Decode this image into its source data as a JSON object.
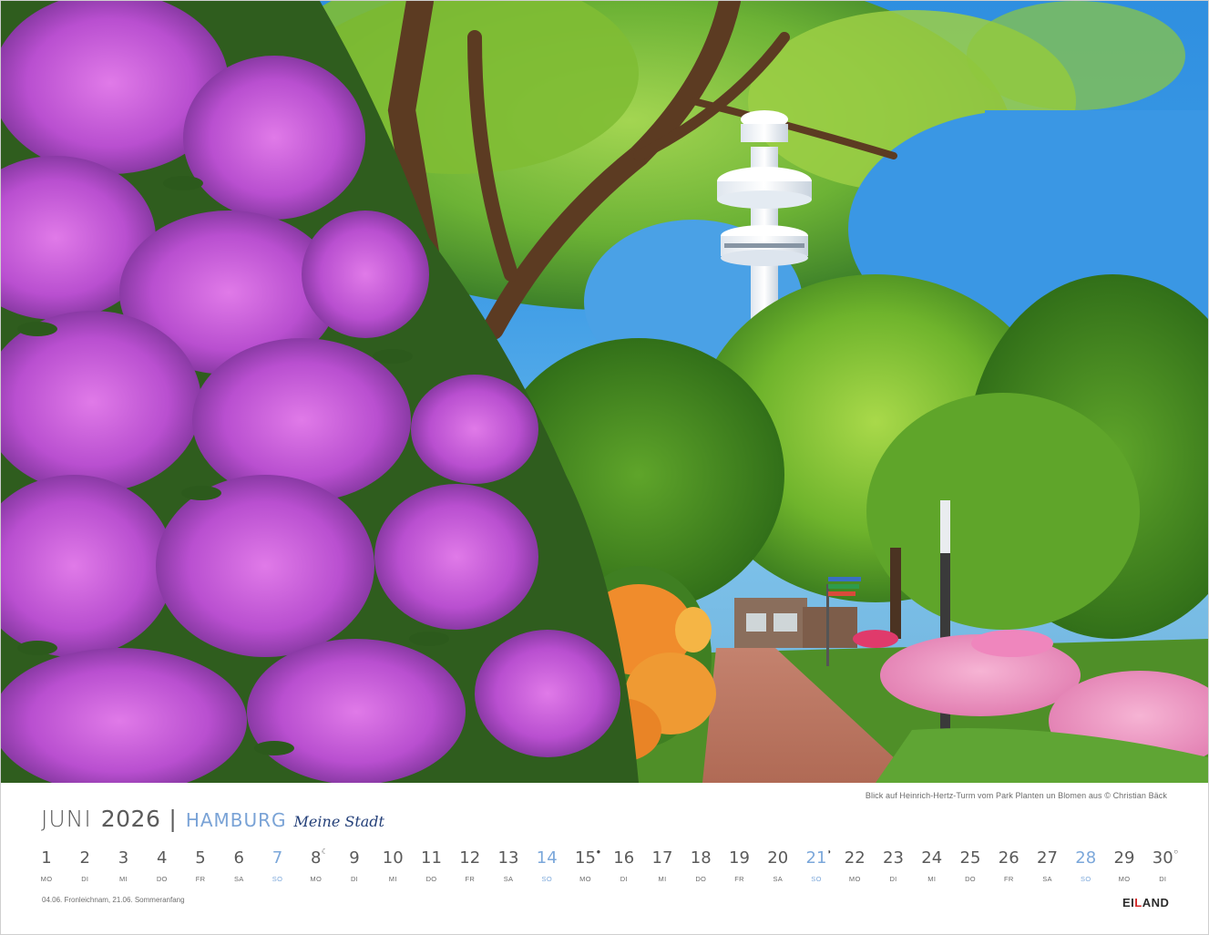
{
  "photo": {
    "credit": "Blick auf Heinrich-Hertz-Turm vom Park Planten un Blomen aus © Christian Bäck"
  },
  "header": {
    "month": "JUNI",
    "year": "2026",
    "separator": "|",
    "city": "HAMBURG",
    "tagline": "Meine Stadt"
  },
  "days": [
    {
      "n": "1",
      "wd": "MO",
      "sun": false,
      "moon": ""
    },
    {
      "n": "2",
      "wd": "DI",
      "sun": false,
      "moon": ""
    },
    {
      "n": "3",
      "wd": "MI",
      "sun": false,
      "moon": ""
    },
    {
      "n": "4",
      "wd": "DO",
      "sun": false,
      "moon": ""
    },
    {
      "n": "5",
      "wd": "FR",
      "sun": false,
      "moon": ""
    },
    {
      "n": "6",
      "wd": "SA",
      "sun": false,
      "moon": ""
    },
    {
      "n": "7",
      "wd": "SO",
      "sun": true,
      "moon": ""
    },
    {
      "n": "8",
      "wd": "MO",
      "sun": false,
      "moon": "last-quarter"
    },
    {
      "n": "9",
      "wd": "DI",
      "sun": false,
      "moon": ""
    },
    {
      "n": "10",
      "wd": "MI",
      "sun": false,
      "moon": ""
    },
    {
      "n": "11",
      "wd": "DO",
      "sun": false,
      "moon": ""
    },
    {
      "n": "12",
      "wd": "FR",
      "sun": false,
      "moon": ""
    },
    {
      "n": "13",
      "wd": "SA",
      "sun": false,
      "moon": ""
    },
    {
      "n": "14",
      "wd": "SO",
      "sun": true,
      "moon": ""
    },
    {
      "n": "15",
      "wd": "MO",
      "sun": false,
      "moon": "new-moon"
    },
    {
      "n": "16",
      "wd": "DI",
      "sun": false,
      "moon": ""
    },
    {
      "n": "17",
      "wd": "MI",
      "sun": false,
      "moon": ""
    },
    {
      "n": "18",
      "wd": "DO",
      "sun": false,
      "moon": ""
    },
    {
      "n": "19",
      "wd": "FR",
      "sun": false,
      "moon": ""
    },
    {
      "n": "20",
      "wd": "SA",
      "sun": false,
      "moon": ""
    },
    {
      "n": "21",
      "wd": "SO",
      "sun": true,
      "moon": "first-quarter"
    },
    {
      "n": "22",
      "wd": "MO",
      "sun": false,
      "moon": ""
    },
    {
      "n": "23",
      "wd": "DI",
      "sun": false,
      "moon": ""
    },
    {
      "n": "24",
      "wd": "MI",
      "sun": false,
      "moon": ""
    },
    {
      "n": "25",
      "wd": "DO",
      "sun": false,
      "moon": ""
    },
    {
      "n": "26",
      "wd": "FR",
      "sun": false,
      "moon": ""
    },
    {
      "n": "27",
      "wd": "SA",
      "sun": false,
      "moon": ""
    },
    {
      "n": "28",
      "wd": "SO",
      "sun": true,
      "moon": ""
    },
    {
      "n": "29",
      "wd": "MO",
      "sun": false,
      "moon": ""
    },
    {
      "n": "30",
      "wd": "DI",
      "sun": false,
      "moon": "full-moon"
    }
  ],
  "footer": {
    "holidays": "04.06. Fronleichnam, 21.06. Sommeranfang",
    "brand_pre": "EI",
    "brand_mark": "L",
    "brand_post": "AND"
  },
  "colors": {
    "sunday": "#7ba7da",
    "city": "#7aa3d6",
    "tagline": "#233f78",
    "text": "#5a5a5a"
  }
}
